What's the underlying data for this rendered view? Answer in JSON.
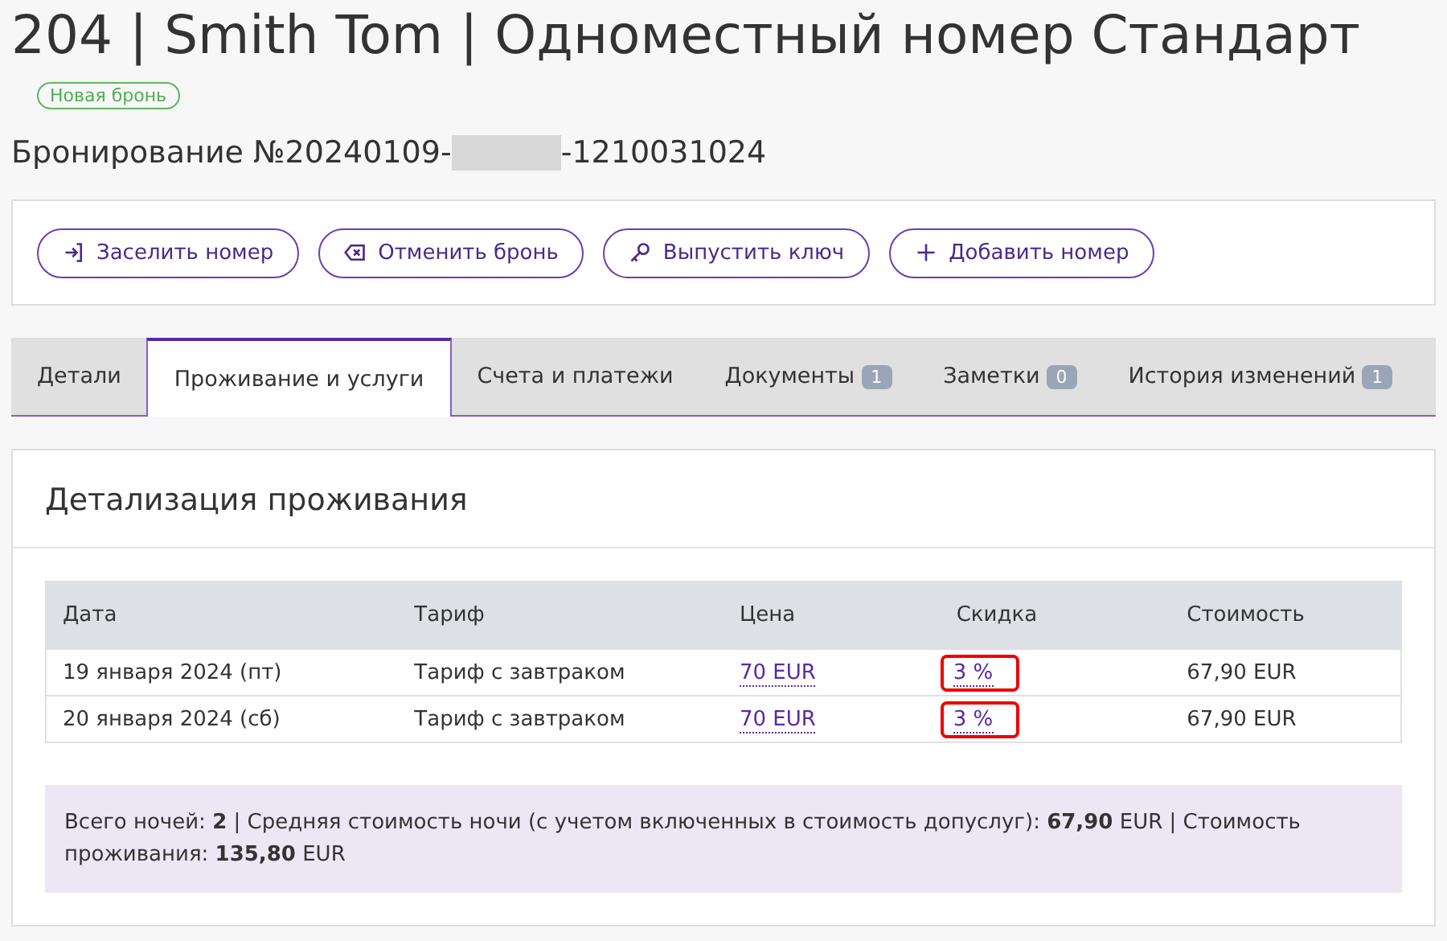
{
  "title": "204 | Smith Tom | Одноместный номер Стандарт",
  "status_badge": "Новая бронь",
  "booking": {
    "prefix": "Бронирование №20240109-",
    "redacted": true,
    "suffix": "-1210031024"
  },
  "actions": [
    {
      "label": "Заселить номер",
      "kind": "checkin"
    },
    {
      "label": "Отменить бронь",
      "kind": "cancel"
    },
    {
      "label": "Выпустить ключ",
      "kind": "key"
    },
    {
      "label": "Добавить номер",
      "kind": "add"
    }
  ],
  "tabs": [
    {
      "label": "Детали",
      "selected": false
    },
    {
      "label": "Проживание и услуги",
      "selected": true
    },
    {
      "label": "Счета и платежи",
      "selected": false
    },
    {
      "label": "Документы",
      "count": "1",
      "selected": false
    },
    {
      "label": "Заметки",
      "count": "0",
      "selected": false
    },
    {
      "label": "История изменений",
      "count": "1",
      "selected": false
    }
  ],
  "section_title": "Детализация проживания",
  "table": {
    "columns": [
      "Дата",
      "Тариф",
      "Цена",
      "Скидка",
      "Стоимость"
    ],
    "rows": [
      {
        "date": "19 января 2024 (пт)",
        "rate": "Тариф с завтраком",
        "price": "70 EUR",
        "discount": "3 %",
        "cost": "67,90 EUR"
      },
      {
        "date": "20 января 2024 (сб)",
        "rate": "Тариф с завтраком",
        "price": "70 EUR",
        "discount": "3 %",
        "cost": "67,90 EUR"
      }
    ],
    "discount_highlighted": true
  },
  "summary": "Всего ночей: **2** | Средняя стоимость ночи (с учетом включенных в стоимость допуслуг): **67,90** EUR | Стоимость проживания: **135,80** EUR"
}
